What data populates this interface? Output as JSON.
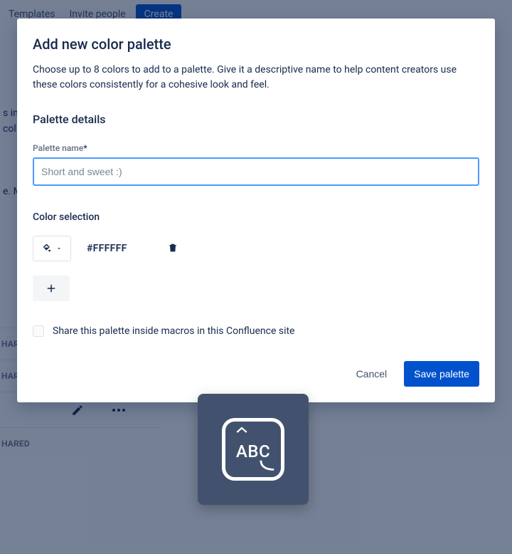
{
  "background": {
    "topbar": {
      "templates": "Templates",
      "invite": "Invite people",
      "create": "Create"
    },
    "left_text_1": "s in",
    "left_text_2": "col",
    "left_text_3": "e. M",
    "row1": "HARE",
    "row2": "HAR",
    "row3": "HARED"
  },
  "modal": {
    "title": "Add new color palette",
    "description": "Choose up to 8 colors to add to a palette. Give it a descriptive name to help content creators use these colors consistently for a cohesive look and feel.",
    "section_details": "Palette details",
    "palette_name_label": "Palette name",
    "palette_name_required": "*",
    "palette_name_placeholder": "Short and sweet :)",
    "palette_name_value": "",
    "section_color": "Color selection",
    "color_hex": "#FFFFFF",
    "share_label": "Share this palette inside macros in this Confluence site",
    "cancel": "Cancel",
    "save": "Save palette"
  },
  "kb_badge": {
    "text": "ABC"
  }
}
